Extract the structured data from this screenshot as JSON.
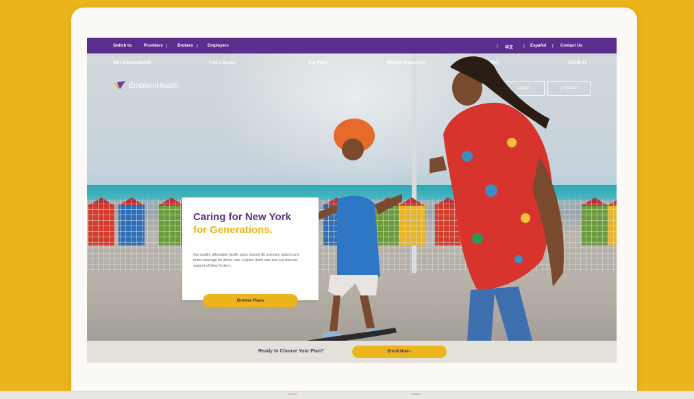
{
  "utility_bar": {
    "switch_to": "Switch to:",
    "providers": "Providers",
    "brokers": "Brokers",
    "employers": "Employers",
    "lang_cn": "中文",
    "lang_es": "Español",
    "contact": "Contact Us"
  },
  "main_nav": {
    "items": [
      "Why EmblemHealth",
      "Find a Doctor",
      "Our Plans",
      "Member Resources",
      "Live Well"
    ],
    "covid": "COVID-19"
  },
  "brand": {
    "name": "EmblemHealth",
    "primary": "#5b2d8d",
    "accent": "#ECB51C"
  },
  "header_buttons": {
    "login": "Log In",
    "search": "Search"
  },
  "hero": {
    "title_line1": "Caring for New York",
    "title_line2": "for Generations.",
    "body": "Our quality, affordable health plans include $0 premium options and more coverage for whole care. Explore them now and see how we support all New Yorkers.",
    "cta": "Browse Plans"
  },
  "enroll": {
    "prompt": "Ready to Choose Your Plan?",
    "button": "Enroll Now ›"
  }
}
